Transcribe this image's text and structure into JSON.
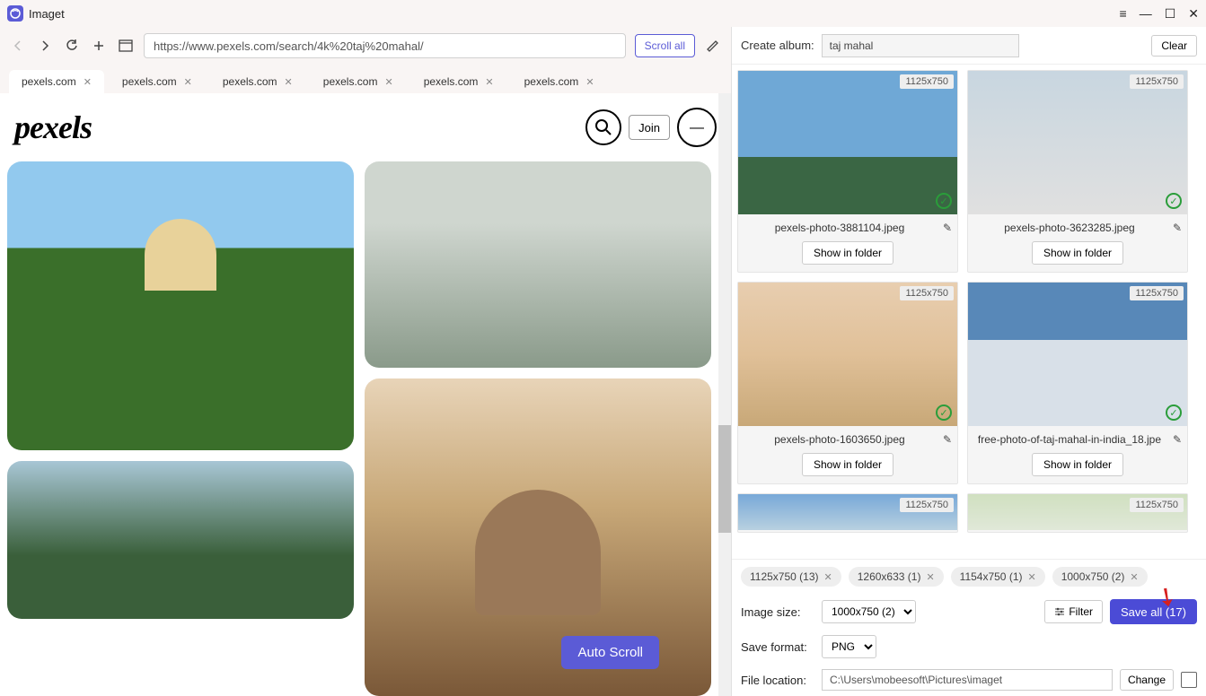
{
  "app": {
    "title": "Imaget"
  },
  "window_controls": {
    "menu": "≡",
    "min": "—",
    "max": "☐",
    "close": "✕"
  },
  "browser": {
    "url": "https://www.pexels.com/search/4k%20taj%20mahal/",
    "scroll_all": "Scroll all",
    "tabs": [
      {
        "label": "pexels.com",
        "active": true
      },
      {
        "label": "pexels.com"
      },
      {
        "label": "pexels.com"
      },
      {
        "label": "pexels.com"
      },
      {
        "label": "pexels.com"
      },
      {
        "label": "pexels.com"
      }
    ]
  },
  "pexels": {
    "logo": "pexels",
    "join": "Join",
    "auto_scroll": "Auto Scroll"
  },
  "right": {
    "create_album_label": "Create album:",
    "album_value": "taj mahal",
    "clear": "Clear",
    "thumbs": [
      {
        "dim": "1125x750",
        "name": "pexels-photo-3881104.jpeg",
        "show": "Show in folder",
        "checked": true,
        "cls": "t1"
      },
      {
        "dim": "1125x750",
        "name": "pexels-photo-3623285.jpeg",
        "show": "Show in folder",
        "checked": true,
        "cls": "t2"
      },
      {
        "dim": "1125x750",
        "name": "pexels-photo-1603650.jpeg",
        "show": "Show in folder",
        "checked": true,
        "cls": "t3"
      },
      {
        "dim": "1125x750",
        "name": "free-photo-of-taj-mahal-in-india_18.jpe",
        "show": "Show in folder",
        "checked": true,
        "cls": "t4"
      },
      {
        "dim": "1125x750",
        "name": "",
        "show": "",
        "cls": "t5",
        "partial": true
      },
      {
        "dim": "1125x750",
        "name": "",
        "show": "",
        "cls": "t6",
        "partial": true
      }
    ],
    "chips": [
      "1125x750 (13)",
      "1260x633 (1)",
      "1154x750 (1)",
      "1000x750 (2)"
    ],
    "image_size_label": "Image size:",
    "image_size_value": "1000x750 (2)",
    "filter": "Filter",
    "save_all": "Save all (17)",
    "save_format_label": "Save format:",
    "save_format_value": "PNG",
    "file_location_label": "File location:",
    "file_location_value": "C:\\Users\\mobeesoft\\Pictures\\imaget",
    "change": "Change"
  }
}
